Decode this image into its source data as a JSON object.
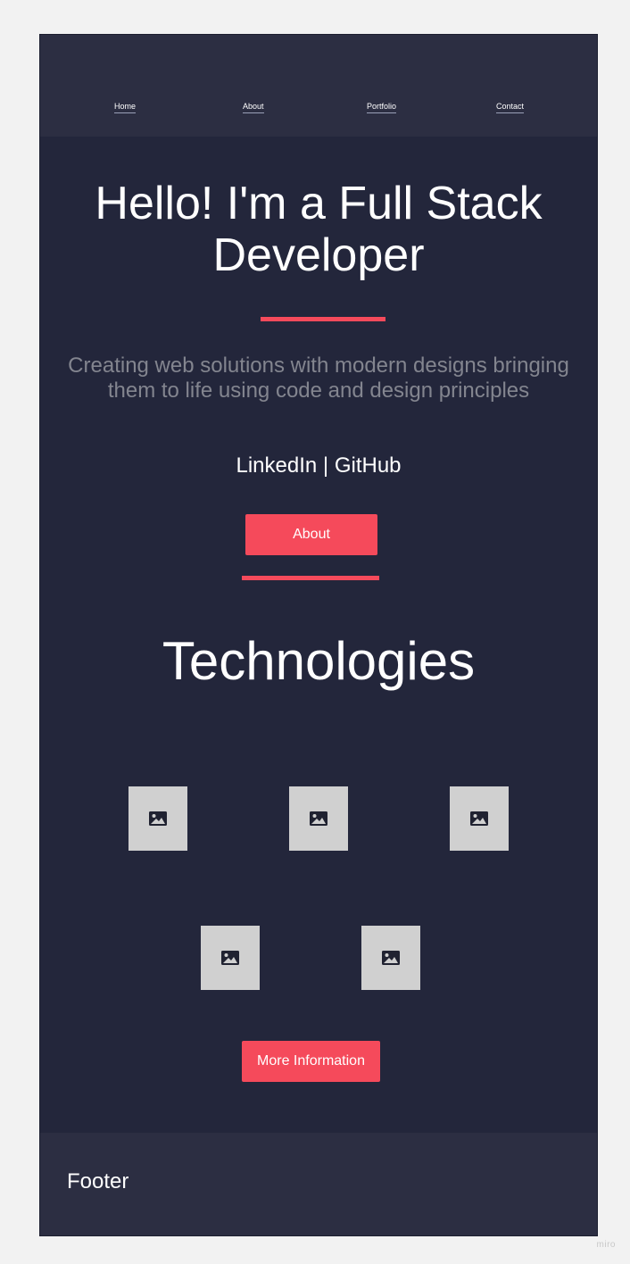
{
  "nav": {
    "items": [
      {
        "label": "Home"
      },
      {
        "label": "About"
      },
      {
        "label": "Portfolio"
      },
      {
        "label": "Contact"
      }
    ]
  },
  "hero": {
    "title_line1": "Hello! I'm a Full Stack",
    "title_line2": "Developer",
    "subtitle_line1": "Creating web solutions with modern designs bringing",
    "subtitle_line2": "them to life using code and design principles",
    "links": {
      "linkedin": "LinkedIn",
      "separator": " | ",
      "github": "GitHub"
    },
    "about_button": "About"
  },
  "technologies": {
    "title": "Technologies",
    "items": [
      {
        "icon": "image-placeholder-icon"
      },
      {
        "icon": "image-placeholder-icon"
      },
      {
        "icon": "image-placeholder-icon"
      },
      {
        "icon": "image-placeholder-icon"
      },
      {
        "icon": "image-placeholder-icon"
      }
    ],
    "more_button": "More Information"
  },
  "footer": {
    "label": "Footer"
  },
  "watermark": "miro",
  "colors": {
    "background": "#23263b",
    "header_footer": "#2c2e42",
    "accent": "#f54a5b",
    "subtitle_text": "#83858f",
    "placeholder_tile": "#d0d0d0",
    "canvas": "#f2f2f2"
  }
}
